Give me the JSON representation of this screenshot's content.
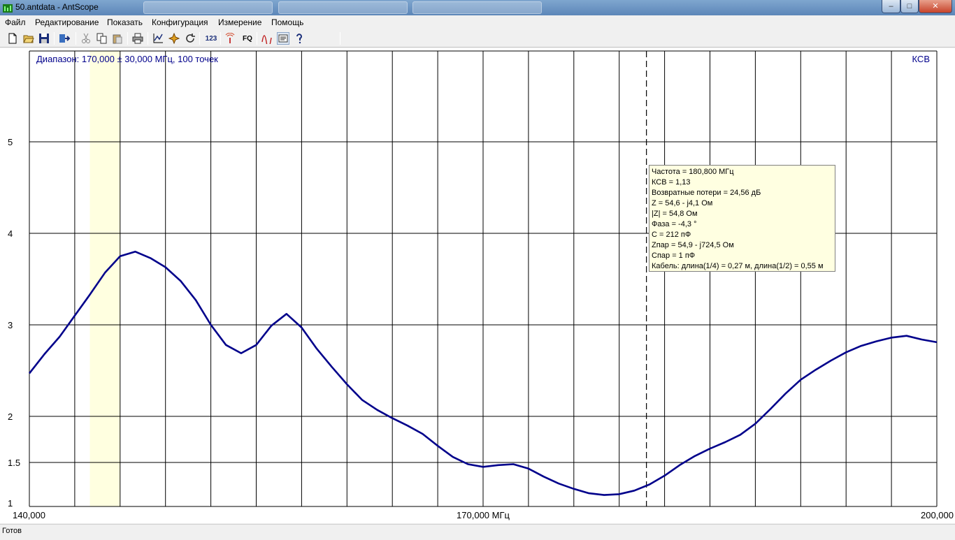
{
  "window": {
    "title": "50.antdata - AntScope",
    "minimize": "–",
    "maximize": "□",
    "close": "✕"
  },
  "menu": [
    "Файл",
    "Редактирование",
    "Показать",
    "Конфигурация",
    "Измерение",
    "Помощь"
  ],
  "toolbar": {
    "icons": [
      "new-file-icon",
      "open-folder-icon",
      "save-icon",
      "export-icon",
      "cut-icon",
      "copy-icon",
      "paste-icon",
      "print-icon",
      "chart-icon",
      "cursor-icon",
      "refresh-icon",
      "numeric-icon",
      "antenna-icon",
      "fq-icon",
      "curve-icon",
      "settings-icon",
      "help-icon"
    ],
    "numeric_label": "123",
    "fq_label": "FQ"
  },
  "chart": {
    "range_label": "Диапазон: 170,000 ± 30,000 МГц, 100 точек",
    "param_label": "КСВ",
    "x_labels": [
      "140,000",
      "170,000 МГц",
      "200,000"
    ]
  },
  "tooltip": {
    "lines": [
      "Частота = 180,800 МГц",
      "КСВ = 1,13",
      "Возвратные потери = 24,56 дБ",
      "Z = 54,6 - j4,1 Ом",
      "|Z| = 54,8 Ом",
      "Фаза = -4,3 °",
      "C = 212 пФ",
      "Zпар = 54,9 - j724,5 Ом",
      "Cпар = 1 пФ",
      "Кабель: длина(1/4) = 0,27 м, длина(1/2) = 0,55 м"
    ]
  },
  "status": "Готов",
  "colors": {
    "curve": "#00008b",
    "highlight": "#ffffe0",
    "label": "#00008b"
  },
  "chart_data": {
    "type": "line",
    "x": [
      140,
      141,
      142,
      143,
      144,
      145,
      146,
      147,
      148,
      149,
      150,
      151,
      152,
      153,
      154,
      155,
      156,
      157,
      158,
      159,
      160,
      161,
      162,
      163,
      164,
      165,
      166,
      167,
      168,
      169,
      170,
      171,
      172,
      173,
      174,
      175,
      176,
      177,
      178,
      179,
      180,
      181,
      182,
      183,
      184,
      185,
      186,
      187,
      188,
      189,
      190,
      191,
      192,
      193,
      194,
      195,
      196,
      197,
      198,
      199,
      200
    ],
    "y": [
      2.47,
      2.68,
      2.87,
      3.1,
      3.33,
      3.57,
      3.75,
      3.8,
      3.73,
      3.63,
      3.48,
      3.27,
      3.0,
      2.78,
      2.69,
      2.78,
      2.99,
      3.12,
      2.97,
      2.74,
      2.54,
      2.35,
      2.18,
      2.07,
      1.98,
      1.9,
      1.81,
      1.68,
      1.56,
      1.48,
      1.45,
      1.47,
      1.48,
      1.43,
      1.34,
      1.26,
      1.2,
      1.15,
      1.13,
      1.14,
      1.18,
      1.25,
      1.35,
      1.47,
      1.57,
      1.65,
      1.72,
      1.8,
      1.92,
      2.08,
      2.25,
      2.4,
      2.51,
      2.61,
      2.7,
      2.77,
      2.82,
      2.86,
      2.88,
      2.84,
      2.81
    ],
    "series_name": "КСВ",
    "xlim": [
      140,
      200
    ],
    "ylim": [
      1,
      6
    ],
    "y_ticks": [
      1,
      1.5,
      2,
      3,
      4,
      5
    ],
    "x_tick_labels": [
      "140,000",
      "170,000 МГц",
      "200,000"
    ],
    "cursor_x": 180.8,
    "highlight_band": [
      144,
      146
    ],
    "grid": true
  }
}
